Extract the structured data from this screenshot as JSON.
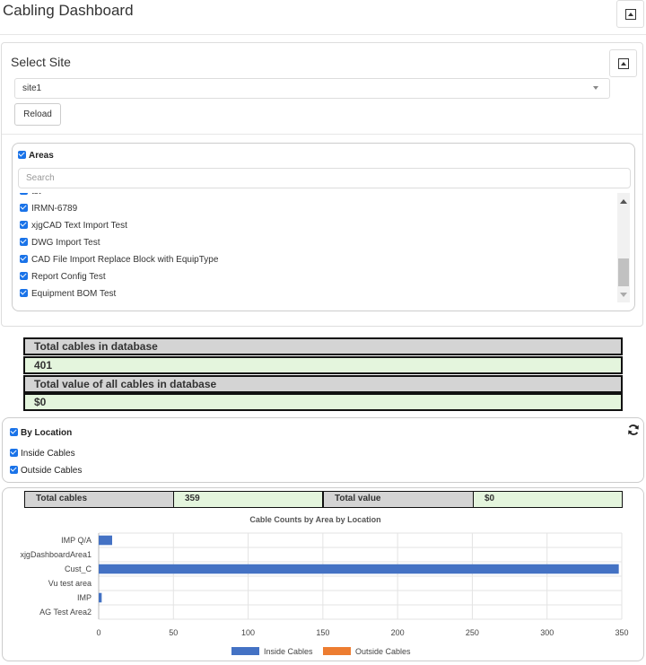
{
  "header": {
    "title": "Cabling Dashboard"
  },
  "site_panel": {
    "title": "Select Site",
    "selected_site": "site1",
    "reload_label": "Reload"
  },
  "areas": {
    "label": "Areas",
    "search_placeholder": "Search",
    "items": [
      "tst",
      "IRMN-6789",
      "xjgCAD Text Import Test",
      "DWG Import Test",
      "CAD File Import Replace Block with EquipType",
      "Report Config Test",
      "Equipment BOM Test"
    ]
  },
  "stats": {
    "total_cables_label": "Total cables in database",
    "total_cables_value": "401",
    "total_value_label": "Total value of all cables in database",
    "total_value_value": "$0"
  },
  "location": {
    "label": "By Location",
    "inside_label": "Inside Cables",
    "outside_label": "Outside Cables"
  },
  "summary": {
    "total_cables_label": "Total cables",
    "total_cables_value": "359",
    "total_value_label": "Total value",
    "total_value_value": "$0"
  },
  "colors": {
    "inside": "#4472c4",
    "outside": "#ed7d31",
    "checkbox": "#1a73e8"
  },
  "chart_data": {
    "type": "bar",
    "orientation": "horizontal",
    "title": "Cable Counts by Area by Location",
    "categories": [
      "IMP Q/A",
      "xjgDashboardArea1",
      "Cust_C",
      "Vu test area",
      "IMP",
      "AG Test Area2"
    ],
    "series": [
      {
        "name": "Inside Cables",
        "values": [
          9,
          0,
          348,
          0,
          2,
          0
        ]
      },
      {
        "name": "Outside Cables",
        "values": [
          0,
          0,
          0,
          0,
          0,
          0
        ]
      }
    ],
    "xticks": [
      0,
      50,
      100,
      150,
      200,
      250,
      300,
      350
    ],
    "xlim": [
      0,
      350
    ],
    "grid": true,
    "legend": "bottom"
  }
}
